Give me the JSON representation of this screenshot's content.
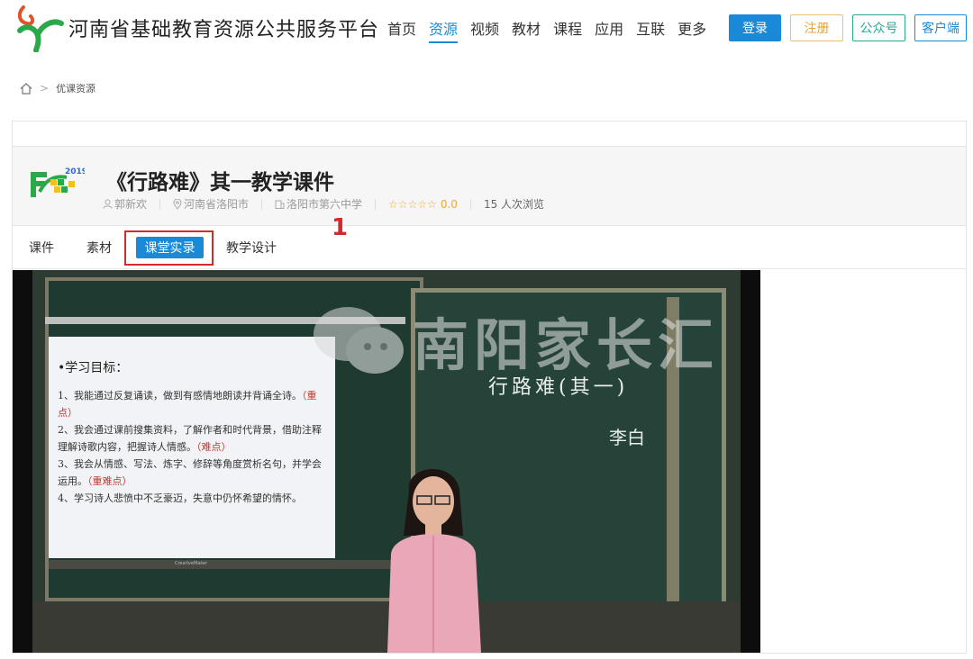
{
  "site": {
    "title": "河南省基础教育资源公共服务平台"
  },
  "nav": [
    {
      "label": "首页",
      "active": false
    },
    {
      "label": "资源",
      "active": true
    },
    {
      "label": "视频",
      "active": false
    },
    {
      "label": "教材",
      "active": false
    },
    {
      "label": "课程",
      "active": false
    },
    {
      "label": "应用",
      "active": false
    },
    {
      "label": "互联",
      "active": false
    },
    {
      "label": "更多",
      "active": false
    }
  ],
  "header_buttons": {
    "login": "登录",
    "register": "注册",
    "gzh": "公众号",
    "client": "客户端"
  },
  "breadcrumb": {
    "current": "优课资源"
  },
  "resource": {
    "badge_year": "2019",
    "title": "《行路难》其一教学课件",
    "author": "郭新欢",
    "location": "河南省洛阳市",
    "school": "洛阳市第六中学",
    "stars": "☆☆☆☆☆",
    "rating": "0.0",
    "views": "15  人次浏览"
  },
  "tabs": {
    "courseware": "课件",
    "materials": "素材",
    "classroom": "课堂实录",
    "design": "教学设计"
  },
  "annotation": {
    "number": "1"
  },
  "video": {
    "watermark": "南阳家长汇",
    "slide_heading": "•学习目标：",
    "slide_lines": [
      {
        "text": "1、我能通过反复诵读，做到有感情地朗读并背诵全诗。",
        "mark": "（重点）"
      },
      {
        "text": "2、我会通过课前搜集资料，了解作者和时代背景，借助注释理解诗歌内容，把握诗人情感。",
        "mark": "（难点）"
      },
      {
        "text": "3、我会从情感、写法、炼字、修辞等角度赏析名句，并学会运用。",
        "mark": "（重难点）"
      },
      {
        "text": "4、学习诗人悲愤中不乏豪迈，失意中仍怀希望的情怀。",
        "mark": ""
      }
    ],
    "chalk_title": "行路难(其一)",
    "chalk_author": "李白",
    "projector_brand": "CreativeMaker"
  },
  "colors": {
    "accent": "#1a8ad8",
    "annotation": "#d22b2b",
    "star": "#f0a830"
  }
}
